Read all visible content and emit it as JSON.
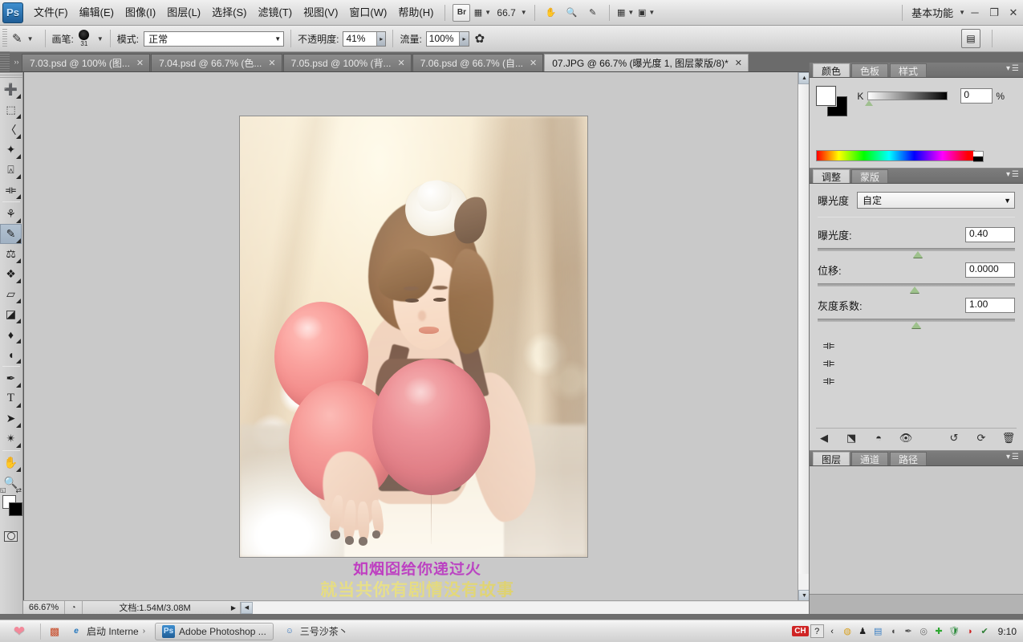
{
  "app": {
    "name": "Adobe Photoshop",
    "logo_text": "Ps",
    "workspace": "基本功能",
    "zoom_dropdown": "66.7"
  },
  "menubar": {
    "items": [
      {
        "label": "文件(F)"
      },
      {
        "label": "编辑(E)"
      },
      {
        "label": "图像(I)"
      },
      {
        "label": "图层(L)"
      },
      {
        "label": "选择(S)"
      },
      {
        "label": "滤镜(T)"
      },
      {
        "label": "视图(V)"
      },
      {
        "label": "窗口(W)"
      },
      {
        "label": "帮助(H)"
      }
    ],
    "bridge_label": "Br",
    "minimize": "─",
    "restore": "❐",
    "close": "✕"
  },
  "optionsbar": {
    "tool": "brush-tool",
    "brush_label": "画笔:",
    "brush_size": "31",
    "mode_label": "模式:",
    "mode_value": "正常",
    "opacity_label": "不透明度:",
    "opacity_value": "41%",
    "flow_label": "流量:",
    "flow_value": "100%"
  },
  "document_tabs": [
    {
      "label": "7.03.psd @ 100% (图...",
      "close": "✕",
      "active": false
    },
    {
      "label": "7.04.psd @ 66.7% (色...",
      "close": "✕",
      "active": false
    },
    {
      "label": "7.05.psd @ 100% (背...",
      "close": "✕",
      "active": false
    },
    {
      "label": "7.06.psd @ 66.7% (自...",
      "close": "✕",
      "active": false
    },
    {
      "label": "07.JPG @ 66.7% (曝光度 1, 图层蒙版/8)*",
      "close": "✕",
      "active": true
    }
  ],
  "toolbar": {
    "tools": [
      {
        "name": "move-tool",
        "glyph": "✥"
      },
      {
        "name": "rectangular-marquee-tool",
        "glyph": "▭"
      },
      {
        "name": "lasso-tool",
        "glyph": "⌁"
      },
      {
        "name": "magic-wand-tool",
        "glyph": "✳"
      },
      {
        "name": "crop-tool",
        "glyph": "⌗"
      },
      {
        "name": "eyedropper-tool",
        "glyph": "⚲"
      },
      {
        "name": "healing-brush-tool",
        "glyph": "⚕"
      },
      {
        "name": "brush-tool",
        "glyph": "✎"
      },
      {
        "name": "clone-stamp-tool",
        "glyph": "⎍"
      },
      {
        "name": "history-brush-tool",
        "glyph": "❧"
      },
      {
        "name": "eraser-tool",
        "glyph": "▱"
      },
      {
        "name": "gradient-tool",
        "glyph": "◨"
      },
      {
        "name": "blur-tool",
        "glyph": "💧"
      },
      {
        "name": "dodge-tool",
        "glyph": "◍"
      },
      {
        "name": "pen-tool",
        "glyph": "✒"
      },
      {
        "name": "type-tool",
        "glyph": "T"
      },
      {
        "name": "path-selection-tool",
        "glyph": "➤"
      },
      {
        "name": "shape-tool",
        "glyph": "✧"
      },
      {
        "name": "hand-tool",
        "glyph": "✋"
      },
      {
        "name": "zoom-tool",
        "glyph": "⚲"
      }
    ],
    "selected_tool": "brush-tool",
    "foreground_color": "#ffffff",
    "background_color": "#000000"
  },
  "color_panel": {
    "tabs": [
      {
        "label": "颜色",
        "active": true
      },
      {
        "label": "色板",
        "active": false
      },
      {
        "label": "样式",
        "active": false
      }
    ],
    "channel_label": "K",
    "channel_value": "0",
    "percent_symbol": "%"
  },
  "adjustment_panel": {
    "tabs": [
      {
        "label": "调整",
        "active": true
      },
      {
        "label": "蒙版",
        "active": false
      }
    ],
    "title": "曝光度",
    "preset": "自定",
    "sliders": [
      {
        "label": "曝光度:",
        "value": "0.40",
        "thumb_pct": 51
      },
      {
        "label": "位移:",
        "value": "0.0000",
        "thumb_pct": 49
      },
      {
        "label": "灰度系数:",
        "value": "1.00",
        "thumb_pct": 50
      }
    ],
    "eyedroppers": [
      {
        "name": "set-black-point-eyedropper",
        "glyph": "⚲"
      },
      {
        "name": "set-gray-point-eyedropper",
        "glyph": "⚲"
      },
      {
        "name": "set-white-point-eyedropper",
        "glyph": "⚲"
      }
    ],
    "footer_buttons": [
      {
        "name": "return-to-adjustment-list-button",
        "glyph": "◀"
      },
      {
        "name": "clip-to-layer-button",
        "glyph": "⬔"
      },
      {
        "name": "toggle-layer-visibility-button",
        "glyph": "◓"
      },
      {
        "name": "preview-eye-button",
        "glyph": "👁"
      },
      {
        "name": "reset-to-previous-state-button",
        "glyph": "↺"
      },
      {
        "name": "reset-adjustment-button",
        "glyph": "⟳"
      },
      {
        "name": "delete-adjustment-layer-button",
        "glyph": "🗑"
      }
    ]
  },
  "layers_panel": {
    "tabs": [
      {
        "label": "图层",
        "active": true
      },
      {
        "label": "通道",
        "active": false
      },
      {
        "label": "路径",
        "active": false
      }
    ]
  },
  "statusbar": {
    "zoom": "66.67%",
    "doc_info": "文档:1.54M/3.08M",
    "arrow": "▶"
  },
  "canvas": {
    "caption_line1": "如烟囵给你递过火",
    "caption_line2": "就当共你有剧情没有故事",
    "image_alt": "woman-with-red-balloons-photo"
  },
  "taskbar": {
    "quicklaunch": [
      {
        "name": "media-player-icon",
        "glyph": "▩"
      }
    ],
    "buttons": [
      {
        "label": "启动 Interne",
        "icon": "internet-explorer-icon",
        "glyph": "e",
        "active": false,
        "chevron": "›"
      },
      {
        "label": "Adobe Photoshop ...",
        "icon": "photoshop-icon",
        "glyph": "Ps",
        "active": true,
        "chevron": ""
      },
      {
        "label": "三号沙茶丶",
        "icon": "qq-icon",
        "glyph": "☺",
        "active": false,
        "chevron": ""
      }
    ],
    "tray": {
      "ime": "CH",
      "help": "?",
      "expand": "‹",
      "icons": [
        {
          "name": "sogou-icon",
          "glyph": "◍",
          "color": "#d8a020"
        },
        {
          "name": "qq-penguin-icon",
          "glyph": "🐧",
          "color": "#222222"
        },
        {
          "name": "network-icon",
          "glyph": "▤",
          "color": "#3a7fc4"
        },
        {
          "name": "volume-icon",
          "glyph": "◖",
          "color": "#4a4a4a"
        },
        {
          "name": "pen-tool-tray-icon",
          "glyph": "✎",
          "color": "#555555"
        },
        {
          "name": "disc-icon",
          "glyph": "◎",
          "color": "#6d6d6d"
        },
        {
          "name": "add-plus-icon",
          "glyph": "✚",
          "color": "#2fa832"
        },
        {
          "name": "shield-icon",
          "glyph": "🛡",
          "color": "#2a8a3a"
        },
        {
          "name": "red-app-icon",
          "glyph": "◑",
          "color": "#cc2222"
        },
        {
          "name": "update-check-icon",
          "glyph": "✔",
          "color": "#2f7f36"
        }
      ],
      "clock": "9:10"
    }
  }
}
